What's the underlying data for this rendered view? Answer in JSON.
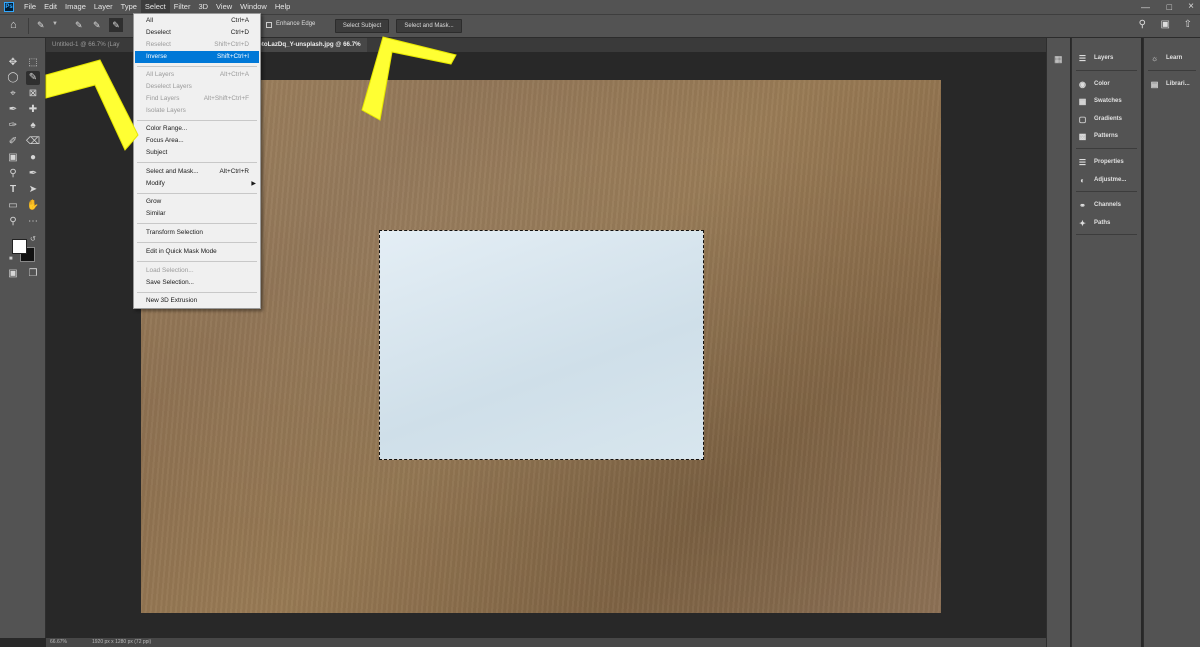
{
  "menubar": {
    "app_icon": "Ps",
    "items": [
      "File",
      "Edit",
      "Image",
      "Layer",
      "Type",
      "Select",
      "Filter",
      "3D",
      "View",
      "Window",
      "Help"
    ],
    "active": "Select"
  },
  "options": {
    "enhance_edge": "Enhance Edge",
    "select_subject": "Select Subject",
    "select_and_mask": "Select and Mask..."
  },
  "tabs": {
    "inactive": "Untitled-1 @ 66.7% (Lay",
    "active": "otoLazDq_Y-unsplash.jpg @ 66.7%"
  },
  "select_menu": {
    "items": [
      {
        "label": "All",
        "shortcut": "Ctrl+A",
        "disabled": false
      },
      {
        "label": "Deselect",
        "shortcut": "Ctrl+D",
        "disabled": false
      },
      {
        "label": "Reselect",
        "shortcut": "Shift+Ctrl+D",
        "disabled": true
      },
      {
        "label": "Inverse",
        "shortcut": "Shift+Ctrl+I",
        "disabled": false,
        "highlighted": true
      },
      {
        "label": "All Layers",
        "shortcut": "Alt+Ctrl+A",
        "disabled": true
      },
      {
        "label": "Deselect Layers",
        "shortcut": "",
        "disabled": true
      },
      {
        "label": "Find Layers",
        "shortcut": "Alt+Shift+Ctrl+F",
        "disabled": true
      },
      {
        "label": "Isolate Layers",
        "shortcut": "",
        "disabled": true
      },
      {
        "label": "Color Range...",
        "shortcut": "",
        "disabled": false
      },
      {
        "label": "Focus Area...",
        "shortcut": "",
        "disabled": false
      },
      {
        "label": "Subject",
        "shortcut": "",
        "disabled": false
      },
      {
        "label": "Select and Mask...",
        "shortcut": "Alt+Ctrl+R",
        "disabled": false
      },
      {
        "label": "Modify",
        "shortcut": "",
        "disabled": false,
        "submenu": true
      },
      {
        "label": "Grow",
        "shortcut": "",
        "disabled": false
      },
      {
        "label": "Similar",
        "shortcut": "",
        "disabled": false
      },
      {
        "label": "Transform Selection",
        "shortcut": "",
        "disabled": false
      },
      {
        "label": "Edit in Quick Mask Mode",
        "shortcut": "",
        "disabled": false
      },
      {
        "label": "Load Selection...",
        "shortcut": "",
        "disabled": true
      },
      {
        "label": "Save Selection...",
        "shortcut": "",
        "disabled": false
      },
      {
        "label": "New 3D Extrusion",
        "shortcut": "",
        "disabled": false
      }
    ]
  },
  "panels": {
    "col1": [
      "Layers",
      "Color",
      "Swatches",
      "Gradients",
      "Patterns",
      "Properties",
      "Adjustme...",
      "Channels",
      "Paths"
    ],
    "col2": [
      "Learn",
      "Librari..."
    ]
  },
  "status": {
    "zoom": "66.67%",
    "doc_info": "1920 px x 1280 px (72 ppi)"
  },
  "colors": {
    "highlight": "#0078d7",
    "annotation": "#ffff33",
    "ui_bg": "#535353"
  }
}
